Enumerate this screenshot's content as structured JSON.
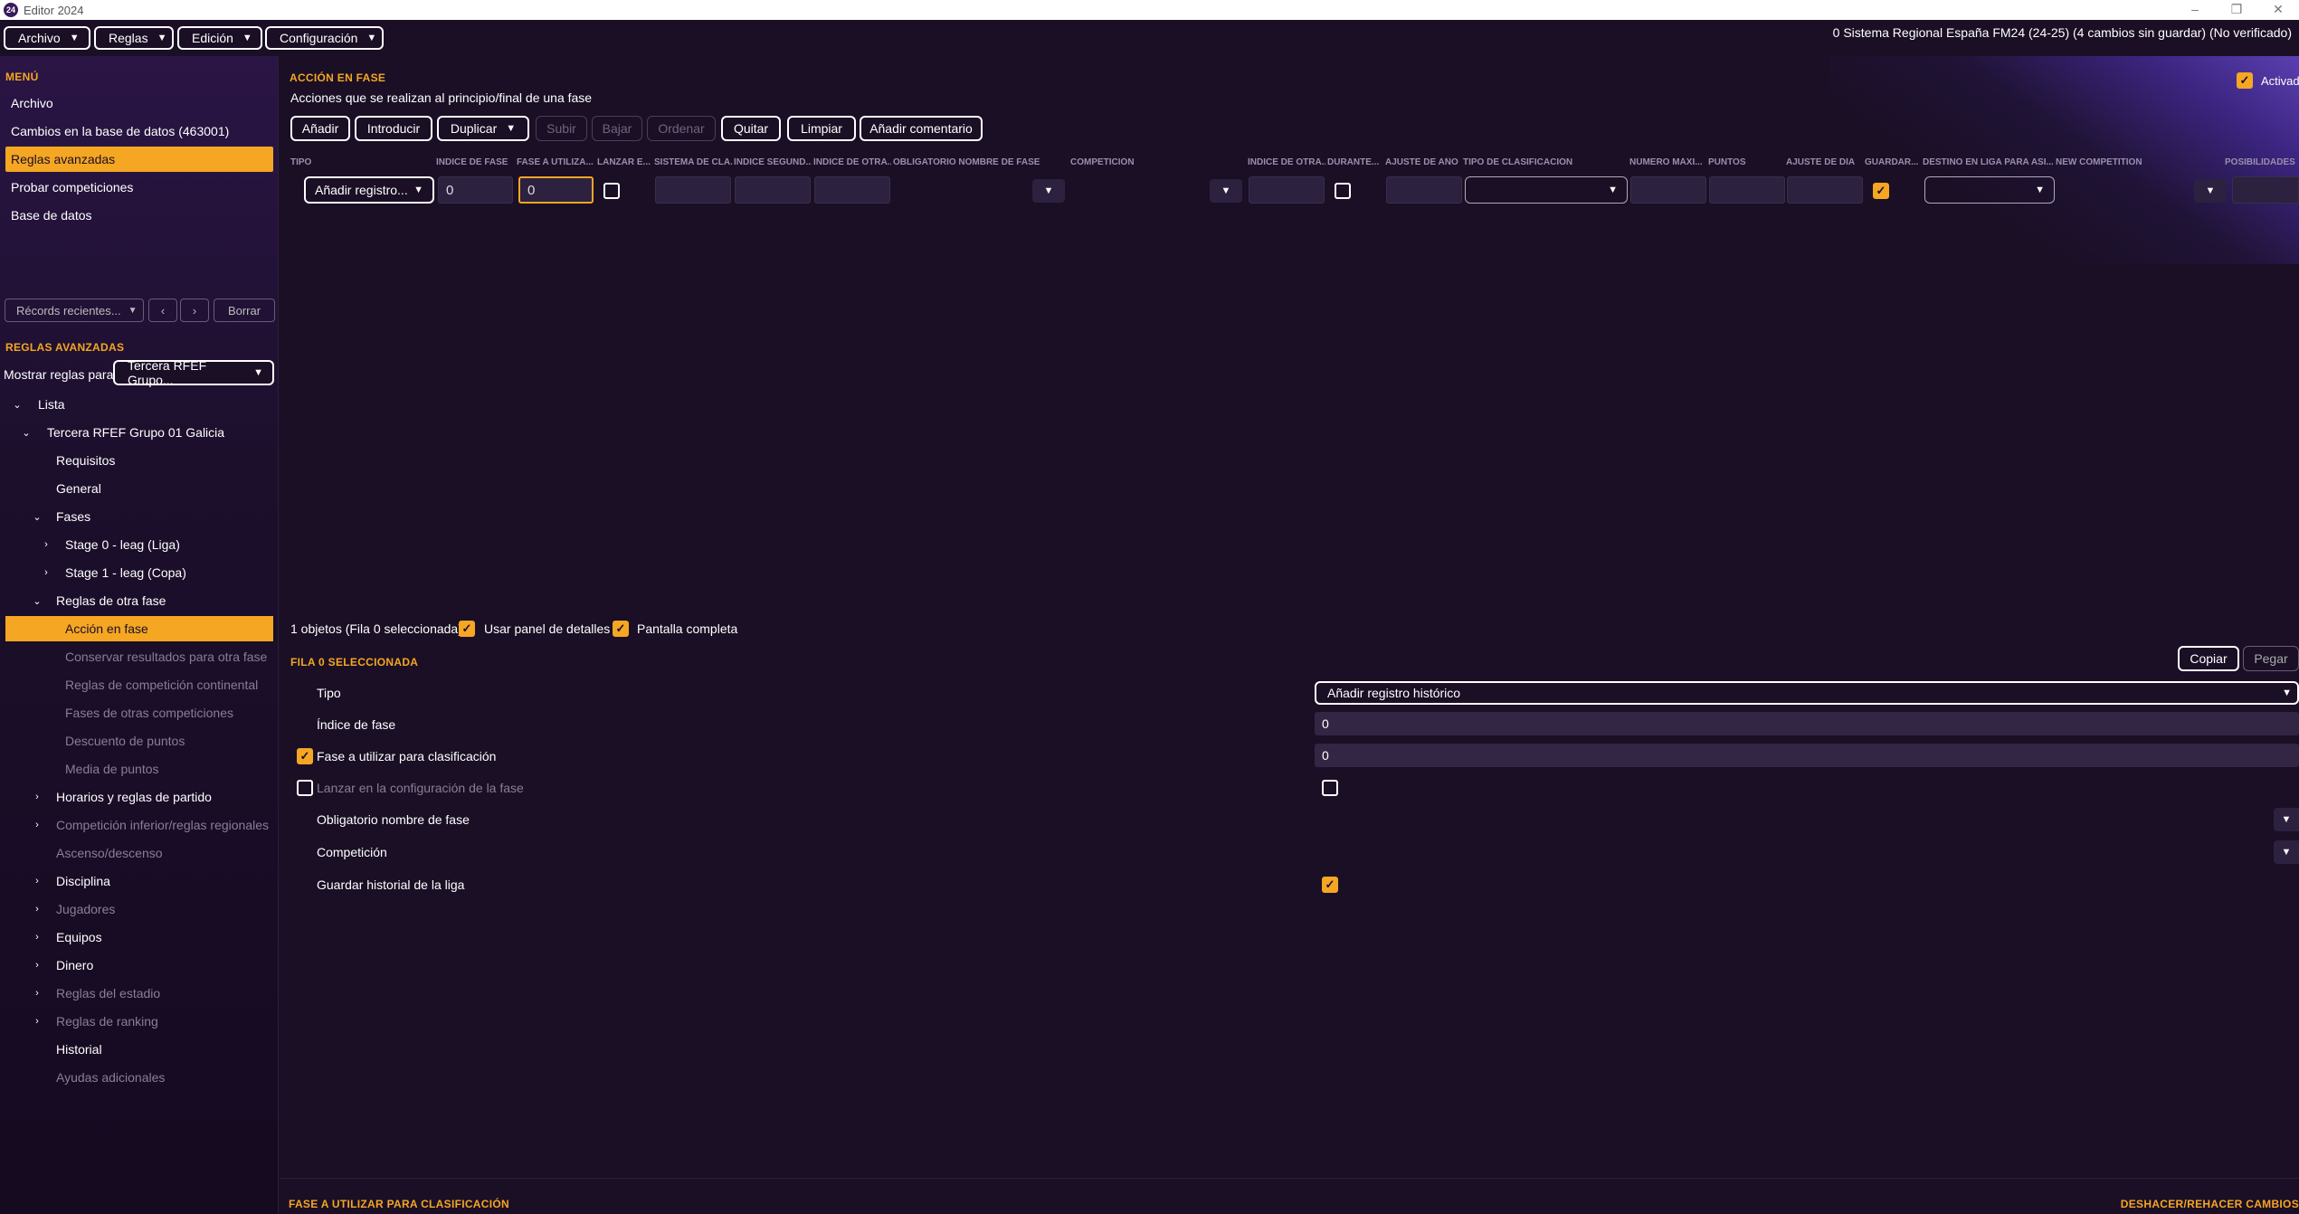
{
  "window": {
    "title": "Editor 2024",
    "app_icon": "24"
  },
  "menubar": {
    "items": [
      "Archivo",
      "Reglas",
      "Edición",
      "Configuración"
    ],
    "status": "0 Sistema Regional España FM24 (24-25) (4 cambios sin guardar) (No verificado)"
  },
  "sidebar": {
    "menu_title": "MENÚ",
    "menu_items": [
      "Archivo",
      "Cambios en la base de datos (463001)",
      "Reglas avanzadas",
      "Probar competiciones",
      "Base de datos"
    ],
    "recent_label": "Récords recientes...",
    "clear_label": "Borrar",
    "rules_title": "REGLAS AVANZADAS",
    "show_rules_label": "Mostrar reglas para",
    "show_rules_value": "Tercera RFEF Grupo...",
    "tree": {
      "lista": "Lista",
      "competition": "Tercera RFEF Grupo 01 Galicia",
      "requisitos": "Requisitos",
      "general": "General",
      "fases": "Fases",
      "stage0": "Stage 0 - leag (Liga)",
      "stage1": "Stage 1 - leag (Copa)",
      "reglas_otra": "Reglas de otra fase",
      "accion": "Acción en fase",
      "conservar": "Conservar resultados para otra fase",
      "continental": "Reglas de competición continental",
      "otras_comp": "Fases de otras competiciones",
      "descuento": "Descuento de puntos",
      "media": "Media de puntos",
      "horarios": "Horarios y reglas de partido",
      "inferior": "Competición inferior/reglas regionales",
      "ascenso": "Ascenso/descenso",
      "disciplina": "Disciplina",
      "jugadores": "Jugadores",
      "equipos": "Equipos",
      "dinero": "Dinero",
      "estadio": "Reglas del estadio",
      "ranking": "Reglas de ranking",
      "historial": "Historial",
      "ayudas": "Ayudas adicionales"
    }
  },
  "main": {
    "title": "ACCIÓN EN FASE",
    "subtitle": "Acciones que se realizan al principio/final de una fase",
    "activated_label": "Activado",
    "toolbar": [
      "Añadir",
      "Introducir",
      "Duplicar",
      "Subir",
      "Bajar",
      "Ordenar",
      "Quitar",
      "Limpiar",
      "Añadir comentario"
    ],
    "columns": [
      "TIPO",
      "ÍNDICE DE FASE",
      "FASE A UTILIZA...",
      "LANZAR E...",
      "SISTEMA DE CLA...",
      "ÍNDICE SEGUND...",
      "ÍNDICE DE OTRA...",
      "OBLIGATORIO NOMBRE DE FASE",
      "COMPETICIÓN",
      "ÍNDICE DE OTRA...",
      "DURANTE...",
      "AJUSTE DE AÑO",
      "TIPO DE CLASIFICACIÓN",
      "NÚMERO MÁXI...",
      "PUNTOS",
      "AJUSTE DE DÍA",
      "GUARDAR...",
      "DESTINO EN LIGA PARA ASI...",
      "NEW COMPETITION",
      "POSIBILIDADES"
    ],
    "row": {
      "tipo": "Añadir registro...",
      "indice_fase": "0",
      "fase_utilizar": "0"
    },
    "objects_status": "1 objetos (Fila 0 seleccionada)",
    "use_details_label": "Usar panel de detalles",
    "fullscreen_label": "Pantalla completa",
    "detail_title": "FILA 0 SELECCIONADA",
    "copy_label": "Copiar",
    "paste_label": "Pegar",
    "details": {
      "tipo_label": "Tipo",
      "tipo_value": "Añadir registro histórico",
      "indice_label": "Índice de fase",
      "indice_value": "0",
      "fase_label": "Fase a utilizar para clasificación",
      "fase_value": "0",
      "lanzar_label": "Lanzar en la configuración de la fase",
      "obligatorio_label": "Obligatorio nombre de fase",
      "competicion_label": "Competición",
      "guardar_label": "Guardar historial de la liga"
    },
    "footer_left": "FASE A UTILIZAR PARA CLASIFICACIÓN",
    "footer_right": "DESHACER/REHACER CAMBIOS"
  },
  "colors": {
    "accent": "#f5a623",
    "background": "#1a0f25",
    "sidebar_top": "#2a1545"
  }
}
